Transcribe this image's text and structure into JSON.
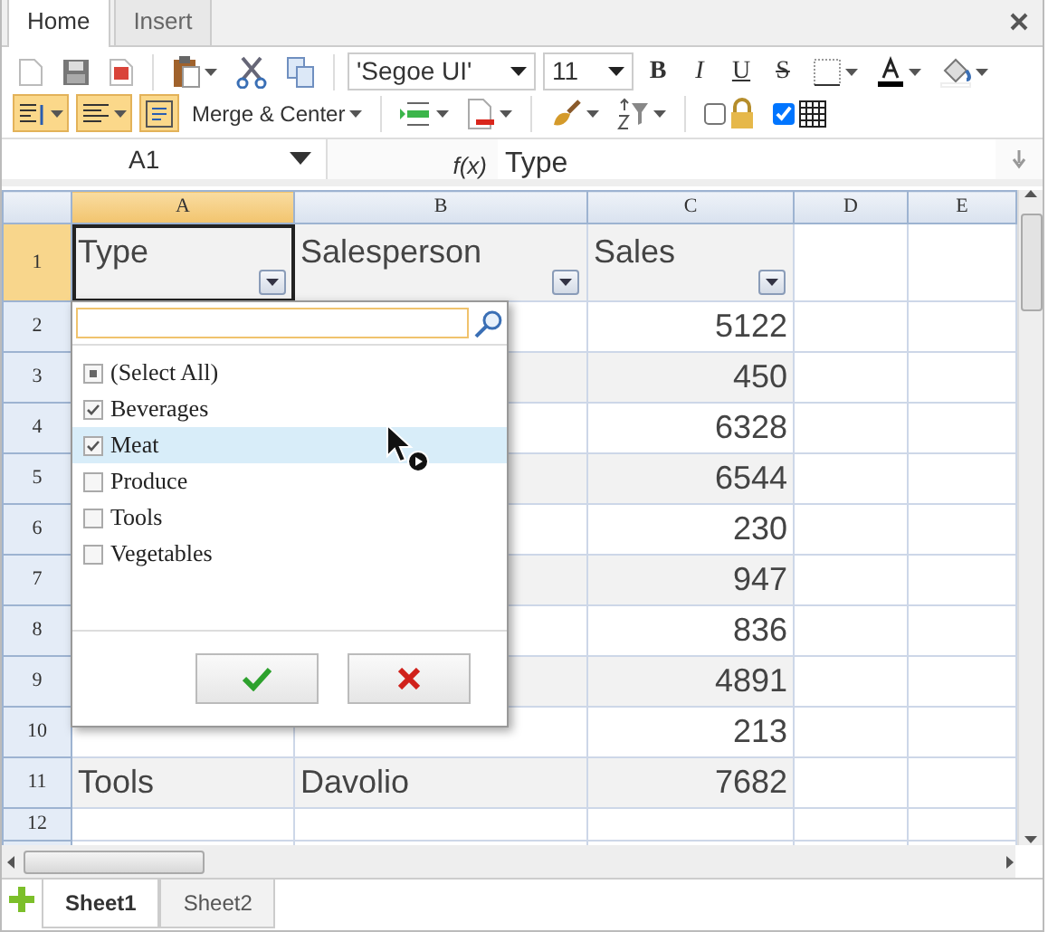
{
  "tabs": [
    {
      "label": "Home",
      "selected": true
    },
    {
      "label": "Insert",
      "selected": false
    }
  ],
  "ribbon": {
    "font": "'Segoe UI'",
    "size": "11",
    "style_buttons": [
      {
        "label": "B",
        "kind": "bold"
      },
      {
        "label": "I",
        "kind": "italic"
      },
      {
        "label": "U",
        "kind": "underline"
      },
      {
        "label": "S",
        "kind": "strike"
      }
    ],
    "align_toggles": [
      {
        "active": true
      },
      {
        "active": true
      },
      {
        "active": true
      }
    ],
    "merge": "Merge & Center",
    "lock_checked": false,
    "gridlines_checked": true
  },
  "formula_bar": {
    "cell": "A1",
    "fx": "f(x)",
    "value": "Type"
  },
  "grid": {
    "columns": [
      {
        "label": "A",
        "selected": true
      },
      {
        "label": "B",
        "selected": false
      },
      {
        "label": "C",
        "selected": false
      },
      {
        "label": "D",
        "selected": false
      },
      {
        "label": "E",
        "selected": false
      }
    ],
    "rows": [
      {
        "label": "1",
        "selected": true,
        "cells": [
          "Type",
          "Salesperson",
          "Sales"
        ]
      },
      {
        "label": "2",
        "selected": false,
        "cells": [
          "",
          "",
          "5122"
        ]
      },
      {
        "label": "3",
        "selected": false,
        "cells": [
          "",
          "",
          "450"
        ]
      },
      {
        "label": "4",
        "selected": false,
        "cells": [
          "",
          "",
          "6328"
        ]
      },
      {
        "label": "5",
        "selected": false,
        "cells": [
          "",
          "",
          "6544"
        ]
      },
      {
        "label": "6",
        "selected": false,
        "cells": [
          "",
          "",
          "230"
        ]
      },
      {
        "label": "7",
        "selected": false,
        "cells": [
          "",
          "",
          "947"
        ]
      },
      {
        "label": "8",
        "selected": false,
        "cells": [
          "",
          "",
          "836"
        ]
      },
      {
        "label": "9",
        "selected": false,
        "cells": [
          "",
          "",
          "4891"
        ]
      },
      {
        "label": "10",
        "selected": false,
        "cells": [
          "",
          "",
          "213"
        ]
      },
      {
        "label": "11",
        "selected": false,
        "cells": [
          "Tools",
          "Davolio",
          "7682"
        ]
      },
      {
        "label": "12",
        "selected": false,
        "cells": [
          "",
          "",
          ""
        ]
      }
    ]
  },
  "filter_popup": {
    "items": [
      {
        "label": "(Select All)",
        "checked": false,
        "indeterminate": true,
        "highlighted": false
      },
      {
        "label": "Beverages",
        "checked": true,
        "indeterminate": false,
        "highlighted": false
      },
      {
        "label": "Meat",
        "checked": true,
        "indeterminate": false,
        "highlighted": true
      },
      {
        "label": "Produce",
        "checked": false,
        "indeterminate": false,
        "highlighted": false
      },
      {
        "label": "Tools",
        "checked": false,
        "indeterminate": false,
        "highlighted": false
      },
      {
        "label": "Vegetables",
        "checked": false,
        "indeterminate": false,
        "highlighted": false
      }
    ]
  },
  "sheet_tabs": [
    {
      "label": "Sheet1",
      "selected": true
    },
    {
      "label": "Sheet2",
      "selected": false
    }
  ]
}
